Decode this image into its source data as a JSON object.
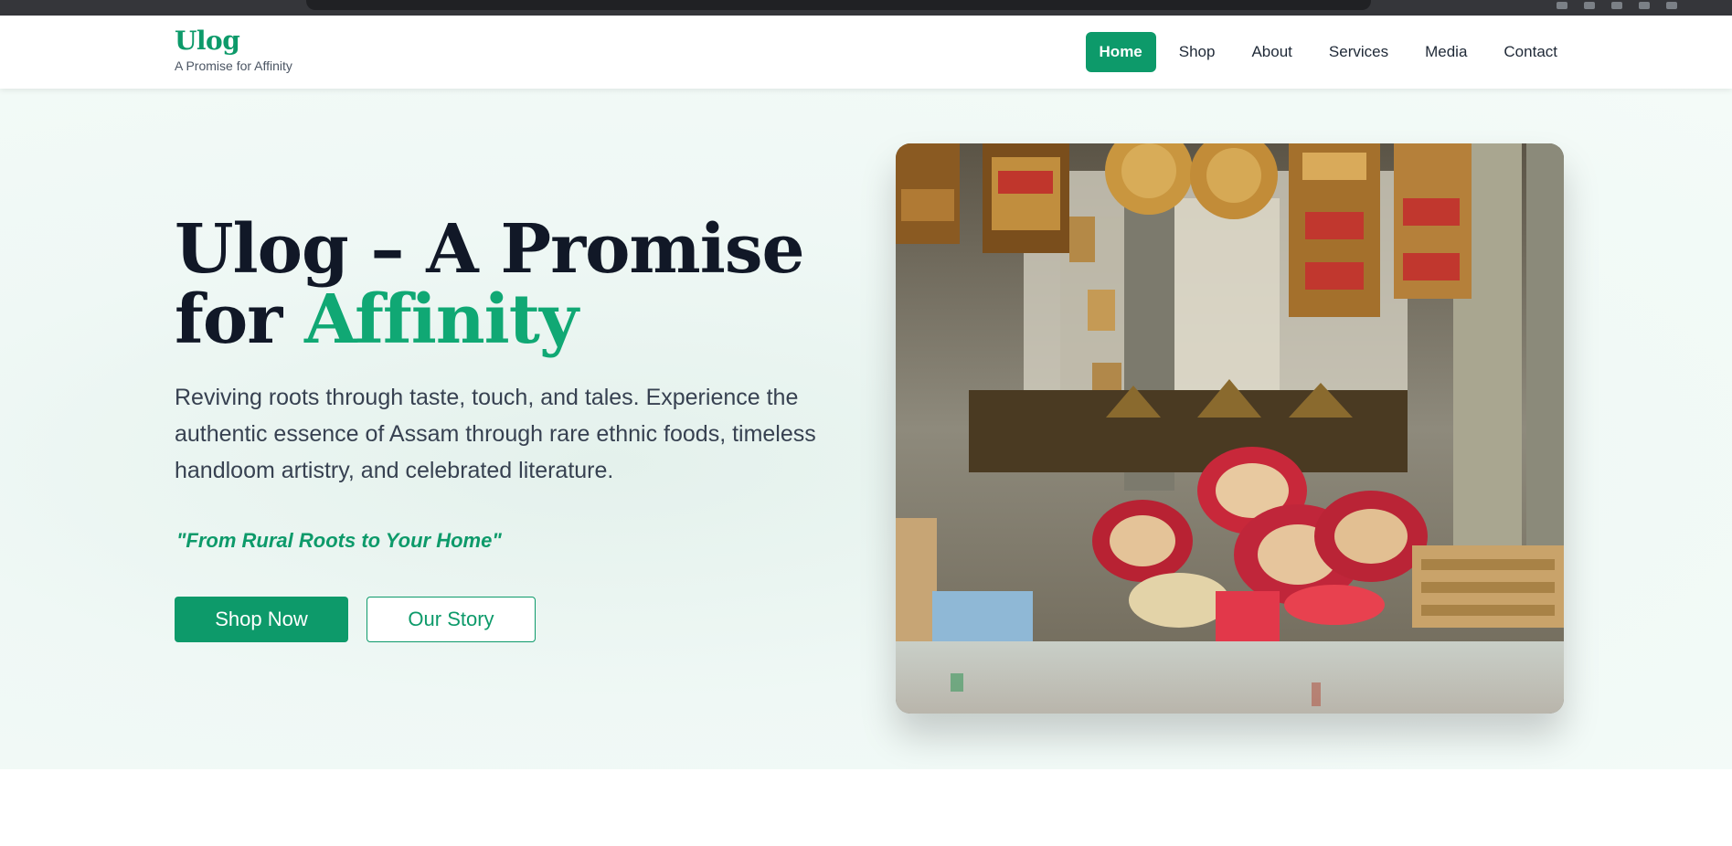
{
  "brand": {
    "name": "Ulog",
    "tagline": "A Promise for Affinity"
  },
  "nav": {
    "items": [
      {
        "label": "Home",
        "active": true
      },
      {
        "label": "Shop"
      },
      {
        "label": "About"
      },
      {
        "label": "Services"
      },
      {
        "label": "Media"
      },
      {
        "label": "Contact"
      }
    ]
  },
  "hero": {
    "title_main": "Ulog – A Promise",
    "title_for": "for",
    "title_accent": "Affinity",
    "description": "Reviving roots through taste, touch, and tales. Experience the authentic essence of Assam through rare ethnic foods, timeless handloom artistry, and celebrated literature.",
    "motto": "\"From Rural Roots to Your Home\"",
    "primary_button": "Shop Now",
    "secondary_button": "Our Story",
    "image_subject": "market-stall-handicrafts"
  },
  "colors": {
    "brand_green": "#0d9a6a",
    "accent_green": "#10a874",
    "heading_dark": "#111827",
    "body_text": "#374151"
  }
}
